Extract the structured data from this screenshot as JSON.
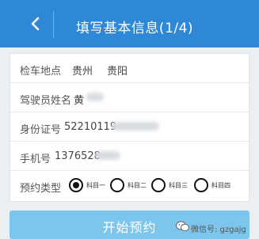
{
  "header": {
    "title": "填写基本信息(1/4)",
    "back_icon": "chevron-left-icon",
    "background": "#2f88d6"
  },
  "form": {
    "location": {
      "label": "检车地点",
      "province": "贵州",
      "city": "贵阳"
    },
    "driver_name": {
      "label": "驾驶员姓名",
      "value": "黄"
    },
    "id_number": {
      "label": "身份证号",
      "value": "52210119"
    },
    "phone": {
      "label": "手机号",
      "value": "1376528"
    },
    "appointment_type": {
      "label": "预约类型",
      "options": [
        "科目一",
        "科目二",
        "科目三",
        "科目四"
      ],
      "selected": "科目一"
    }
  },
  "start_button": {
    "label": "开始预约",
    "color": "#7cc6ee"
  },
  "watermark": {
    "text": "微信号: gzgajg"
  }
}
